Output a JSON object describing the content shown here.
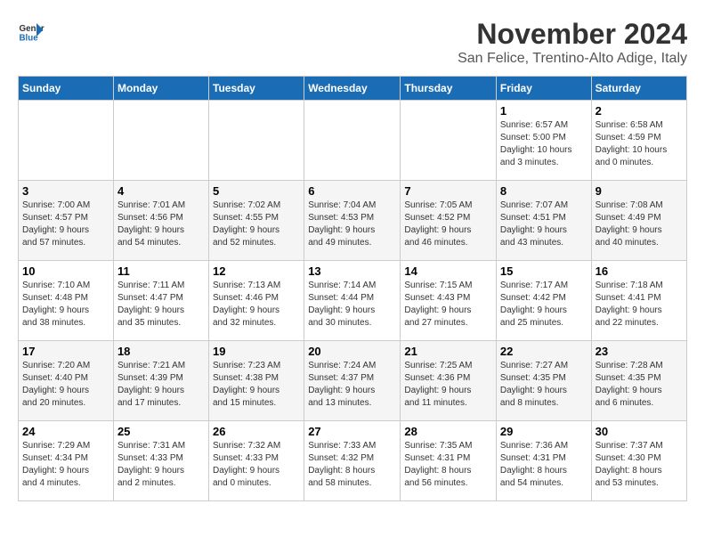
{
  "logo": {
    "line1": "General",
    "line2": "Blue"
  },
  "title": "November 2024",
  "subtitle": "San Felice, Trentino-Alto Adige, Italy",
  "header": {
    "days": [
      "Sunday",
      "Monday",
      "Tuesday",
      "Wednesday",
      "Thursday",
      "Friday",
      "Saturday"
    ]
  },
  "weeks": [
    {
      "cells": [
        {
          "day": "",
          "info": ""
        },
        {
          "day": "",
          "info": ""
        },
        {
          "day": "",
          "info": ""
        },
        {
          "day": "",
          "info": ""
        },
        {
          "day": "",
          "info": ""
        },
        {
          "day": "1",
          "info": "Sunrise: 6:57 AM\nSunset: 5:00 PM\nDaylight: 10 hours\nand 3 minutes."
        },
        {
          "day": "2",
          "info": "Sunrise: 6:58 AM\nSunset: 4:59 PM\nDaylight: 10 hours\nand 0 minutes."
        }
      ]
    },
    {
      "cells": [
        {
          "day": "3",
          "info": "Sunrise: 7:00 AM\nSunset: 4:57 PM\nDaylight: 9 hours\nand 57 minutes."
        },
        {
          "day": "4",
          "info": "Sunrise: 7:01 AM\nSunset: 4:56 PM\nDaylight: 9 hours\nand 54 minutes."
        },
        {
          "day": "5",
          "info": "Sunrise: 7:02 AM\nSunset: 4:55 PM\nDaylight: 9 hours\nand 52 minutes."
        },
        {
          "day": "6",
          "info": "Sunrise: 7:04 AM\nSunset: 4:53 PM\nDaylight: 9 hours\nand 49 minutes."
        },
        {
          "day": "7",
          "info": "Sunrise: 7:05 AM\nSunset: 4:52 PM\nDaylight: 9 hours\nand 46 minutes."
        },
        {
          "day": "8",
          "info": "Sunrise: 7:07 AM\nSunset: 4:51 PM\nDaylight: 9 hours\nand 43 minutes."
        },
        {
          "day": "9",
          "info": "Sunrise: 7:08 AM\nSunset: 4:49 PM\nDaylight: 9 hours\nand 40 minutes."
        }
      ]
    },
    {
      "cells": [
        {
          "day": "10",
          "info": "Sunrise: 7:10 AM\nSunset: 4:48 PM\nDaylight: 9 hours\nand 38 minutes."
        },
        {
          "day": "11",
          "info": "Sunrise: 7:11 AM\nSunset: 4:47 PM\nDaylight: 9 hours\nand 35 minutes."
        },
        {
          "day": "12",
          "info": "Sunrise: 7:13 AM\nSunset: 4:46 PM\nDaylight: 9 hours\nand 32 minutes."
        },
        {
          "day": "13",
          "info": "Sunrise: 7:14 AM\nSunset: 4:44 PM\nDaylight: 9 hours\nand 30 minutes."
        },
        {
          "day": "14",
          "info": "Sunrise: 7:15 AM\nSunset: 4:43 PM\nDaylight: 9 hours\nand 27 minutes."
        },
        {
          "day": "15",
          "info": "Sunrise: 7:17 AM\nSunset: 4:42 PM\nDaylight: 9 hours\nand 25 minutes."
        },
        {
          "day": "16",
          "info": "Sunrise: 7:18 AM\nSunset: 4:41 PM\nDaylight: 9 hours\nand 22 minutes."
        }
      ]
    },
    {
      "cells": [
        {
          "day": "17",
          "info": "Sunrise: 7:20 AM\nSunset: 4:40 PM\nDaylight: 9 hours\nand 20 minutes."
        },
        {
          "day": "18",
          "info": "Sunrise: 7:21 AM\nSunset: 4:39 PM\nDaylight: 9 hours\nand 17 minutes."
        },
        {
          "day": "19",
          "info": "Sunrise: 7:23 AM\nSunset: 4:38 PM\nDaylight: 9 hours\nand 15 minutes."
        },
        {
          "day": "20",
          "info": "Sunrise: 7:24 AM\nSunset: 4:37 PM\nDaylight: 9 hours\nand 13 minutes."
        },
        {
          "day": "21",
          "info": "Sunrise: 7:25 AM\nSunset: 4:36 PM\nDaylight: 9 hours\nand 11 minutes."
        },
        {
          "day": "22",
          "info": "Sunrise: 7:27 AM\nSunset: 4:35 PM\nDaylight: 9 hours\nand 8 minutes."
        },
        {
          "day": "23",
          "info": "Sunrise: 7:28 AM\nSunset: 4:35 PM\nDaylight: 9 hours\nand 6 minutes."
        }
      ]
    },
    {
      "cells": [
        {
          "day": "24",
          "info": "Sunrise: 7:29 AM\nSunset: 4:34 PM\nDaylight: 9 hours\nand 4 minutes."
        },
        {
          "day": "25",
          "info": "Sunrise: 7:31 AM\nSunset: 4:33 PM\nDaylight: 9 hours\nand 2 minutes."
        },
        {
          "day": "26",
          "info": "Sunrise: 7:32 AM\nSunset: 4:33 PM\nDaylight: 9 hours\nand 0 minutes."
        },
        {
          "day": "27",
          "info": "Sunrise: 7:33 AM\nSunset: 4:32 PM\nDaylight: 8 hours\nand 58 minutes."
        },
        {
          "day": "28",
          "info": "Sunrise: 7:35 AM\nSunset: 4:31 PM\nDaylight: 8 hours\nand 56 minutes."
        },
        {
          "day": "29",
          "info": "Sunrise: 7:36 AM\nSunset: 4:31 PM\nDaylight: 8 hours\nand 54 minutes."
        },
        {
          "day": "30",
          "info": "Sunrise: 7:37 AM\nSunset: 4:30 PM\nDaylight: 8 hours\nand 53 minutes."
        }
      ]
    }
  ]
}
